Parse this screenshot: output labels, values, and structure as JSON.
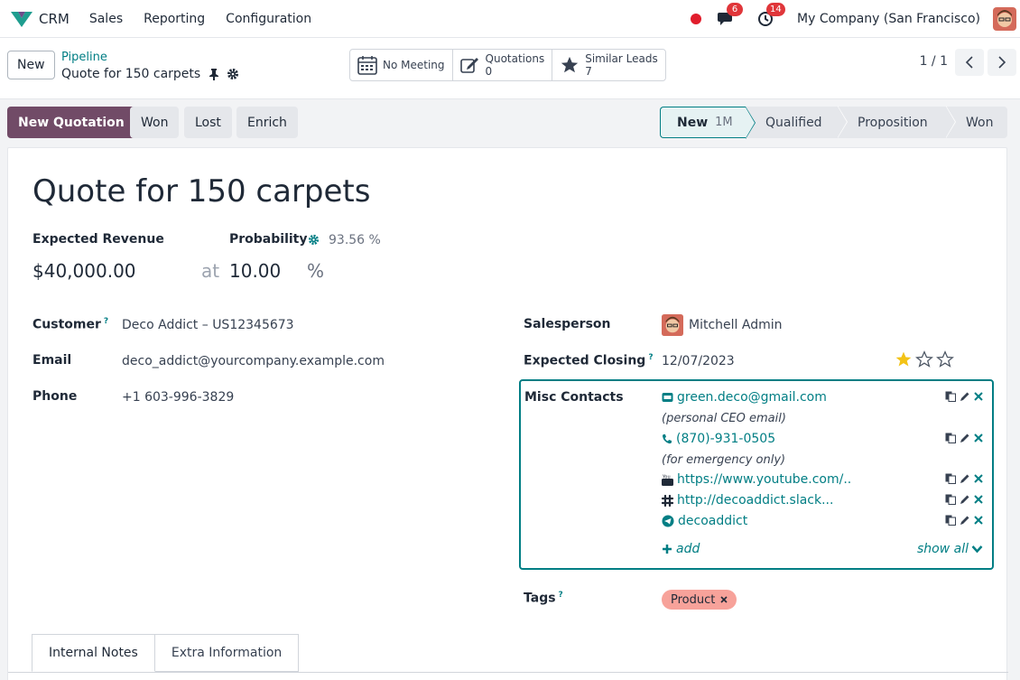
{
  "navbar": {
    "app_name": "CRM",
    "menus": [
      "Sales",
      "Reporting",
      "Configuration"
    ],
    "messages_count": "6",
    "activities_count": "14",
    "company": "My Company (San Francisco)"
  },
  "control_panel": {
    "new_label": "New",
    "breadcrumb": "Pipeline",
    "record_name": "Quote for 150 carpets",
    "smart_buttons": {
      "meeting": "No Meeting",
      "quotations_label": "Quotations",
      "quotations_count": "0",
      "similar_label": "Similar Leads",
      "similar_count": "7"
    },
    "pager": "1 / 1"
  },
  "actions": {
    "new_quotation": "New Quotation",
    "won": "Won",
    "lost": "Lost",
    "enrich": "Enrich"
  },
  "stages": {
    "new": "New",
    "new_count": "1M",
    "qualified": "Qualified",
    "proposition": "Proposition",
    "won": "Won"
  },
  "lead": {
    "title": "Quote for 150 carpets",
    "expected_revenue_label": "Expected Revenue",
    "expected_revenue": "$40,000.00",
    "probability_label": "Probability",
    "probability_auto": "93.56 %",
    "at_label": "at",
    "probability": "10.00",
    "percent_sign": "%",
    "customer_label": "Customer",
    "customer": "Deco Addict – US12345673",
    "email_label": "Email",
    "email": "deco_addict@yourcompany.example.com",
    "phone_label": "Phone",
    "phone": "+1 603-996-3829",
    "salesperson_label": "Salesperson",
    "salesperson": "Mitchell Admin",
    "closing_label": "Expected Closing",
    "closing": "12/07/2023",
    "priority_stars": 1,
    "misc_label": "Misc Contacts",
    "misc_contacts": {
      "email": "green.deco@gmail.com",
      "email_note": "(personal CEO email)",
      "phone": "(870)-931-0505",
      "phone_note": "(for emergency only)",
      "youtube": "https://www.youtube.com/..",
      "slack": "http://decoaddict.slack...",
      "telegram": "decoaddict",
      "add": "add",
      "show_all": "show all"
    },
    "tags_label": "Tags",
    "tag": "Product"
  },
  "tabs": [
    "Internal Notes",
    "Extra Information"
  ],
  "colors": {
    "primary": "#714b67",
    "accent": "#017e84",
    "tag": "#f7a29a",
    "star": "#f3c316"
  }
}
